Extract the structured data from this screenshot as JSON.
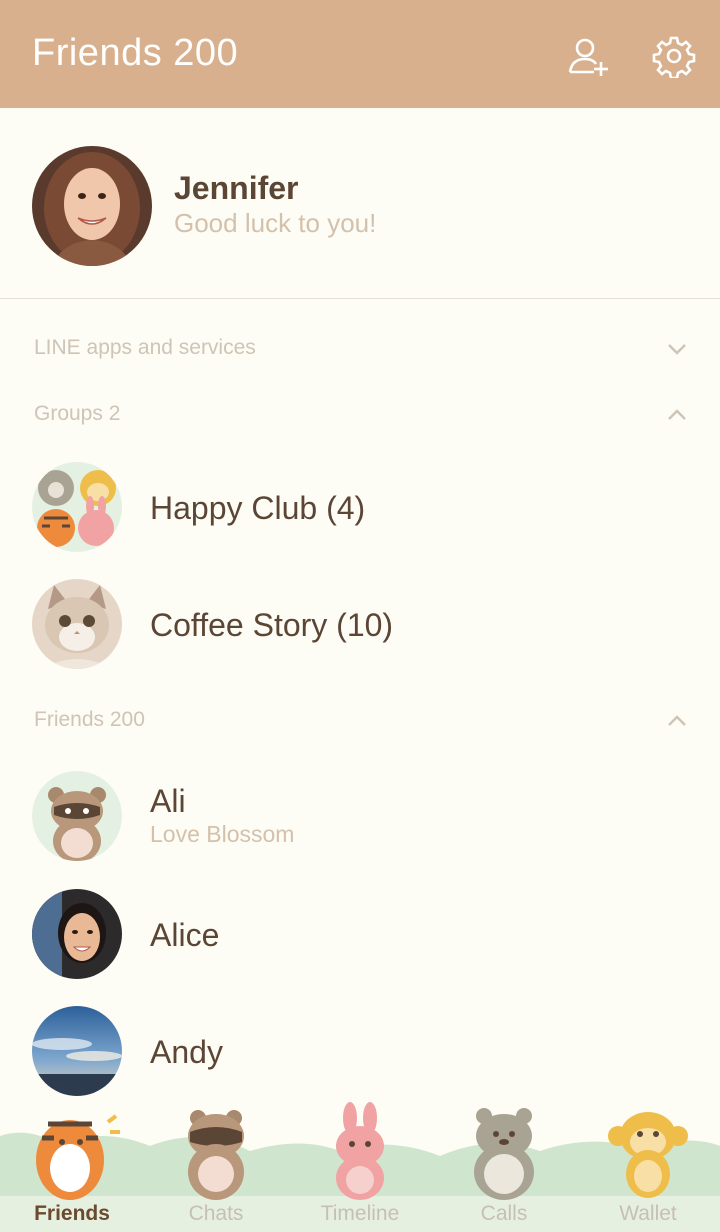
{
  "header": {
    "title": "Friends 200"
  },
  "profile": {
    "name": "Jennifer",
    "status": "Good luck to you!"
  },
  "sections": {
    "apps": "LINE apps and services",
    "groups": "Groups 2",
    "friends": "Friends 200"
  },
  "groups": [
    {
      "name": "Happy Club (4)"
    },
    {
      "name": "Coffee Story (10)"
    }
  ],
  "friends": [
    {
      "name": "Ali",
      "status": "Love Blossom"
    },
    {
      "name": "Alice"
    },
    {
      "name": "Andy"
    }
  ],
  "tabs": [
    {
      "label": "Friends",
      "icon": "tiger-icon"
    },
    {
      "label": "Chats",
      "icon": "raccoon-icon"
    },
    {
      "label": "Timeline",
      "icon": "rabbit-icon"
    },
    {
      "label": "Calls",
      "icon": "bear-icon"
    },
    {
      "label": "Wallet",
      "icon": "monkey-icon"
    }
  ],
  "colors": {
    "header": "#d8b08d",
    "background": "#fdfcf5",
    "text": "#5b4636",
    "muted": "#d4c1ac",
    "grass": "#cfe5cd"
  }
}
